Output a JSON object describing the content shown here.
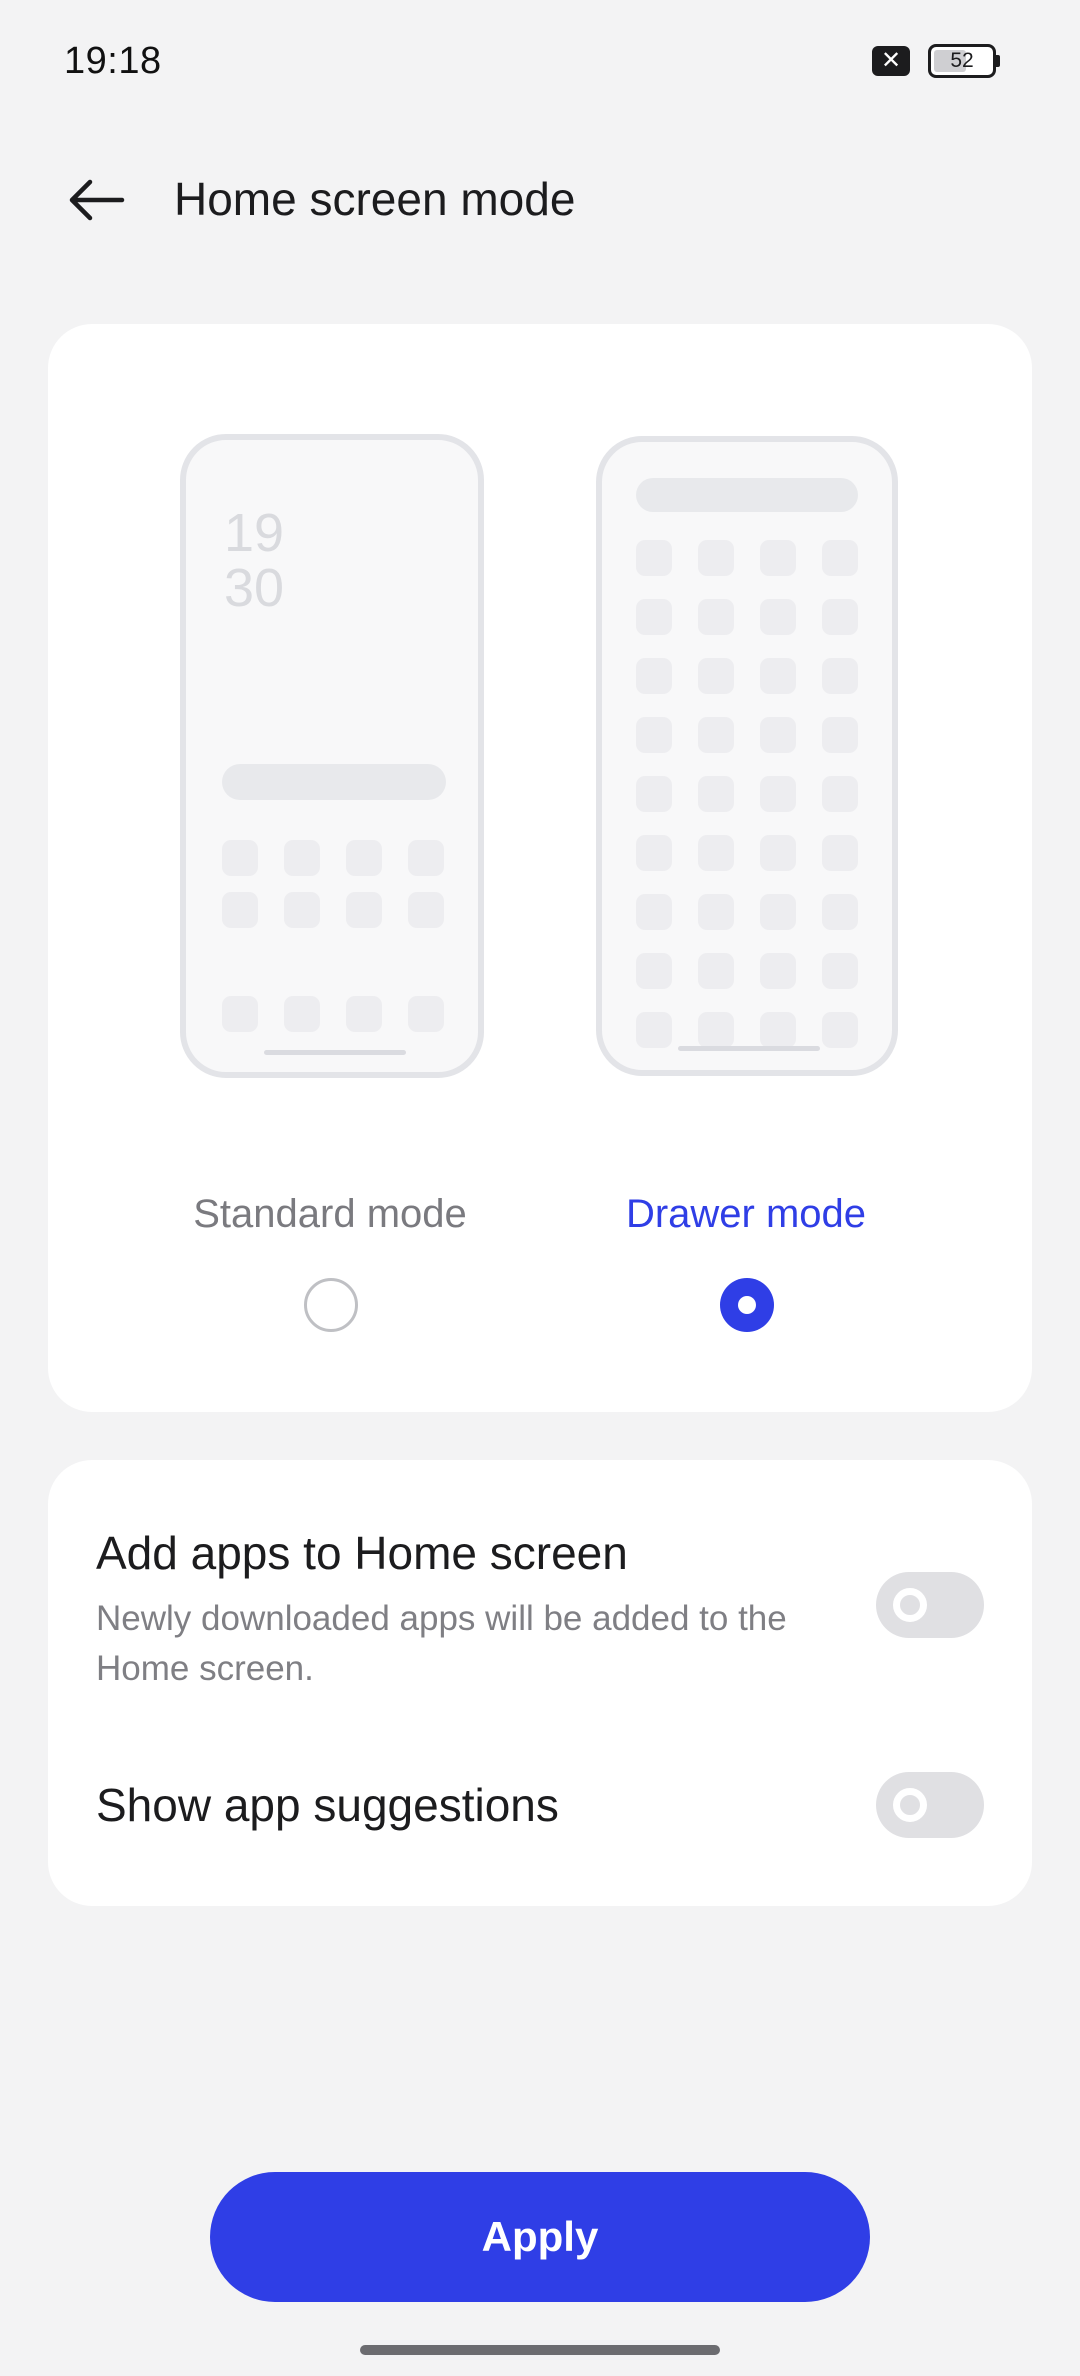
{
  "status_bar": {
    "time": "19:18",
    "battery_level": "52",
    "sim_icon": "sim-disabled-icon"
  },
  "header": {
    "title": "Home screen mode",
    "back_icon": "arrow-left-icon"
  },
  "preview": {
    "standard_clock_hour": "19",
    "standard_clock_minute": "30"
  },
  "modes": {
    "standard_label": "Standard mode",
    "drawer_label": "Drawer mode",
    "selected": "Drawer mode"
  },
  "settings": {
    "add_apps_title": "Add apps to Home screen",
    "add_apps_desc": "Newly downloaded apps will be added to the Home screen.",
    "add_apps_enabled": false,
    "suggestions_title": "Show app suggestions",
    "suggestions_enabled": false
  },
  "apply_label": "Apply",
  "colors": {
    "accent": "#2f3ee6",
    "background": "#f3f3f4",
    "card": "#ffffff"
  }
}
